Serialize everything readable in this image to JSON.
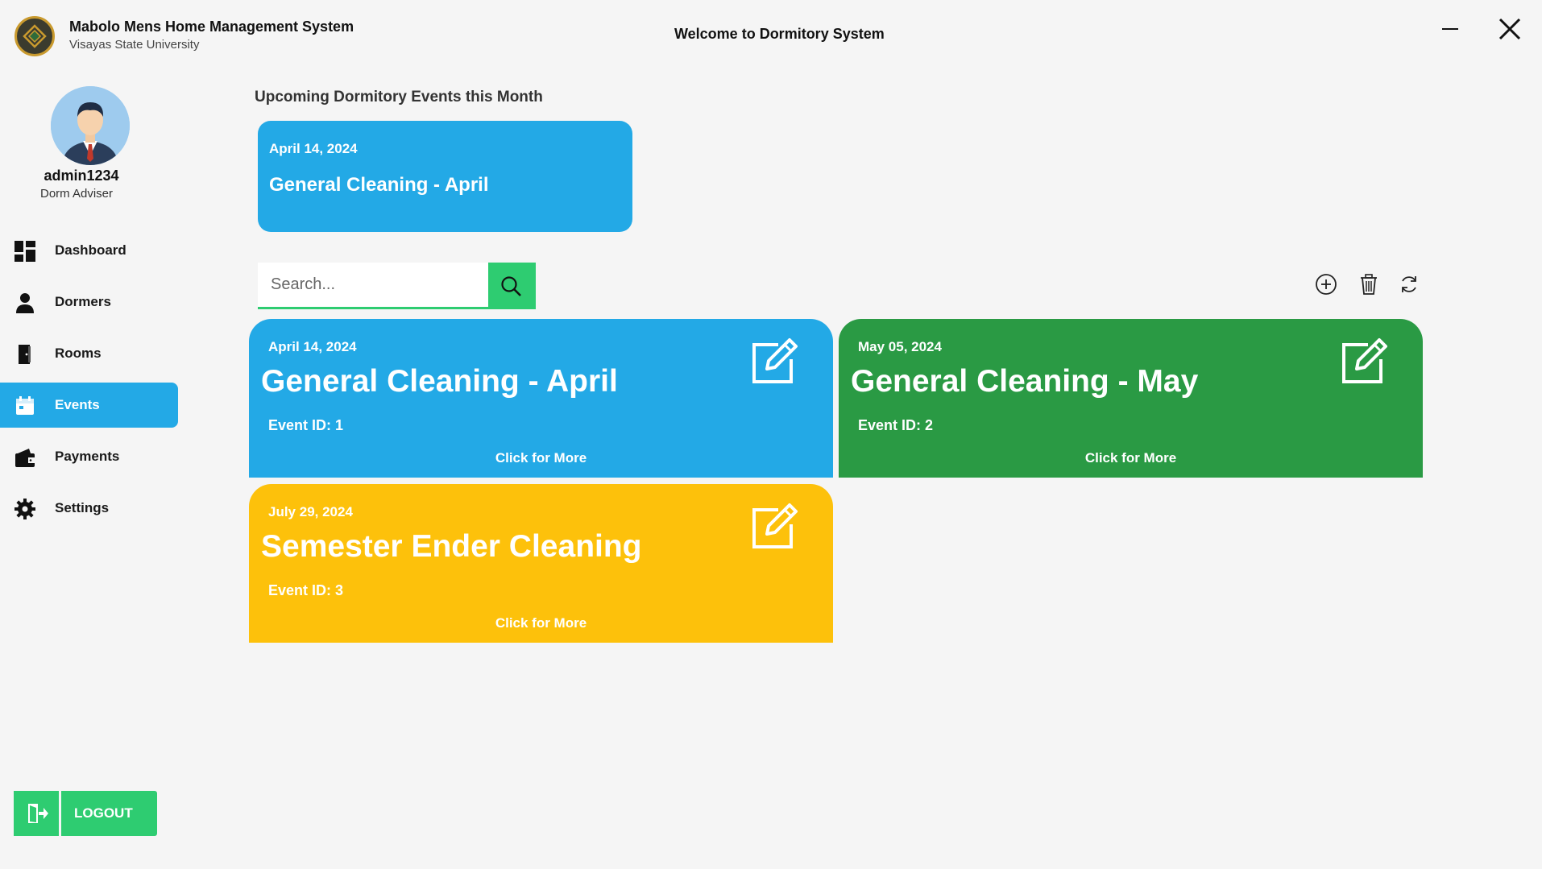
{
  "app": {
    "title": "Mabolo Mens Home Management System",
    "subtitle": "Visayas State University",
    "welcome": "Welcome to Dormitory System"
  },
  "profile": {
    "username": "admin1234",
    "role": "Dorm Adviser"
  },
  "sidebar": {
    "items": [
      {
        "label": "Dashboard",
        "icon": "dashboard-icon"
      },
      {
        "label": "Dormers",
        "icon": "user-icon"
      },
      {
        "label": "Rooms",
        "icon": "door-icon"
      },
      {
        "label": "Events",
        "icon": "calendar-icon",
        "active": true
      },
      {
        "label": "Payments",
        "icon": "wallet-icon"
      },
      {
        "label": "Settings",
        "icon": "gear-icon"
      }
    ],
    "logout_label": "LOGOUT"
  },
  "upcoming": {
    "heading": "Upcoming Dormitory Events this Month",
    "date": "April 14, 2024",
    "title": "General Cleaning - April"
  },
  "search": {
    "placeholder": "Search..."
  },
  "events": [
    {
      "date": "April 14, 2024",
      "title": "General Cleaning - April",
      "event_id": "Event ID: 1",
      "more": "Click for More",
      "color": "#23a9e6"
    },
    {
      "date": "May 05, 2024",
      "title": "General Cleaning - May",
      "event_id": "Event ID: 2",
      "more": "Click for More",
      "color": "#2a9a44"
    },
    {
      "date": "July 29, 2024",
      "title": "Semester Ender Cleaning",
      "event_id": "Event ID: 3",
      "more": "Click for More",
      "color": "#fdc10b"
    }
  ],
  "colors": {
    "accent_blue": "#23a9e6",
    "accent_green": "#2ecc71",
    "event_green": "#2a9a44",
    "event_yellow": "#fdc10b"
  }
}
